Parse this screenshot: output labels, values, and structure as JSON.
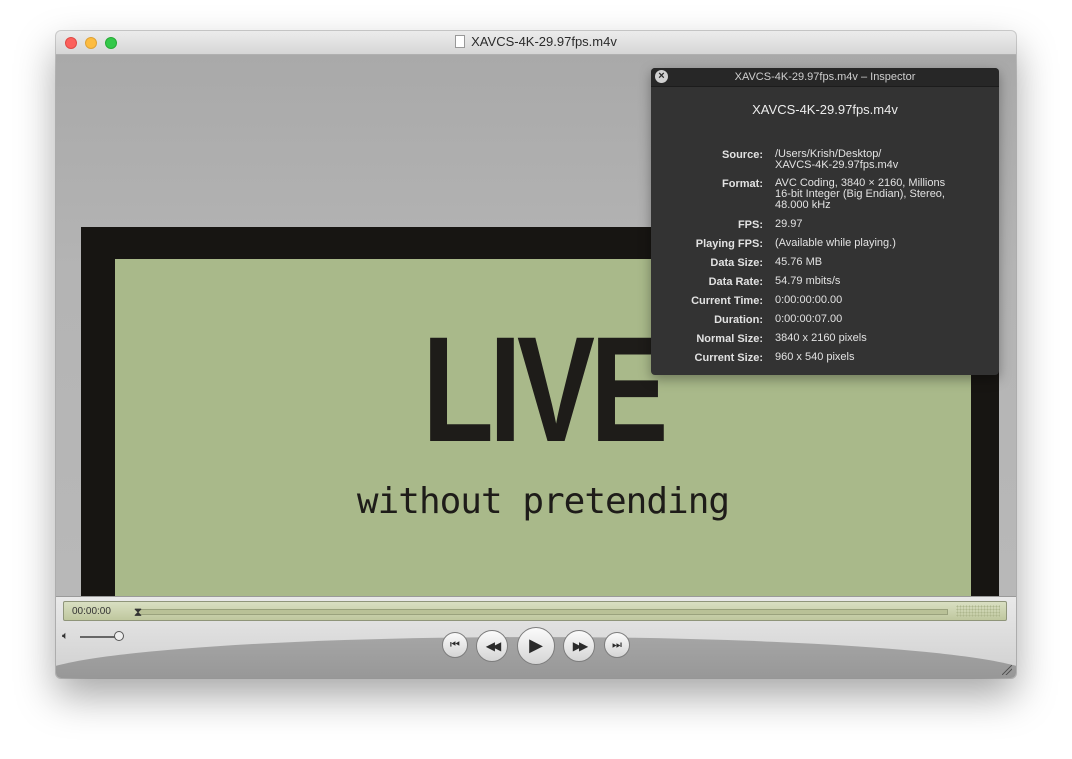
{
  "window": {
    "title": "XAVCS-4K-29.97fps.m4v"
  },
  "video": {
    "sign_headline": "LIVE",
    "sign_tagline": "without pretending"
  },
  "inspector": {
    "title": "XAVCS-4K-29.97fps.m4v – Inspector",
    "filename": "XAVCS-4K-29.97fps.m4v",
    "rows": [
      {
        "label": "Source:",
        "value": [
          "/Users/Krish/Desktop/",
          "XAVCS-4K-29.97fps.m4v"
        ]
      },
      {
        "label": "Format:",
        "value": [
          "AVC Coding, 3840 × 2160, Millions",
          "16-bit Integer (Big Endian), Stereo,",
          "48.000 kHz"
        ]
      },
      {
        "label": "FPS:",
        "value": [
          "29.97"
        ]
      },
      {
        "label": "Playing FPS:",
        "value": [
          "(Available while playing.)"
        ]
      },
      {
        "label": "Data Size:",
        "value": [
          "45.76 MB"
        ]
      },
      {
        "label": "Data Rate:",
        "value": [
          "54.79 mbits/s"
        ]
      },
      {
        "label": "Current Time:",
        "value": [
          "0:00:00:00.00"
        ]
      },
      {
        "label": "Duration:",
        "value": [
          "0:00:00:07.00"
        ]
      },
      {
        "label": "Normal Size:",
        "value": [
          "3840 x 2160 pixels"
        ]
      },
      {
        "label": "Current Size:",
        "value": [
          "960 x 540 pixels"
        ]
      }
    ]
  },
  "controls": {
    "current_time": "00:00:00",
    "playhead_progress": 0.0,
    "volume_level": 1.0,
    "icons": {
      "volume": "speaker-icon",
      "skip_back": "skip-to-start-icon",
      "rewind": "rewind-icon",
      "play": "play-icon",
      "forward": "fast-forward-icon",
      "skip_forward": "skip-to-end-icon"
    }
  }
}
